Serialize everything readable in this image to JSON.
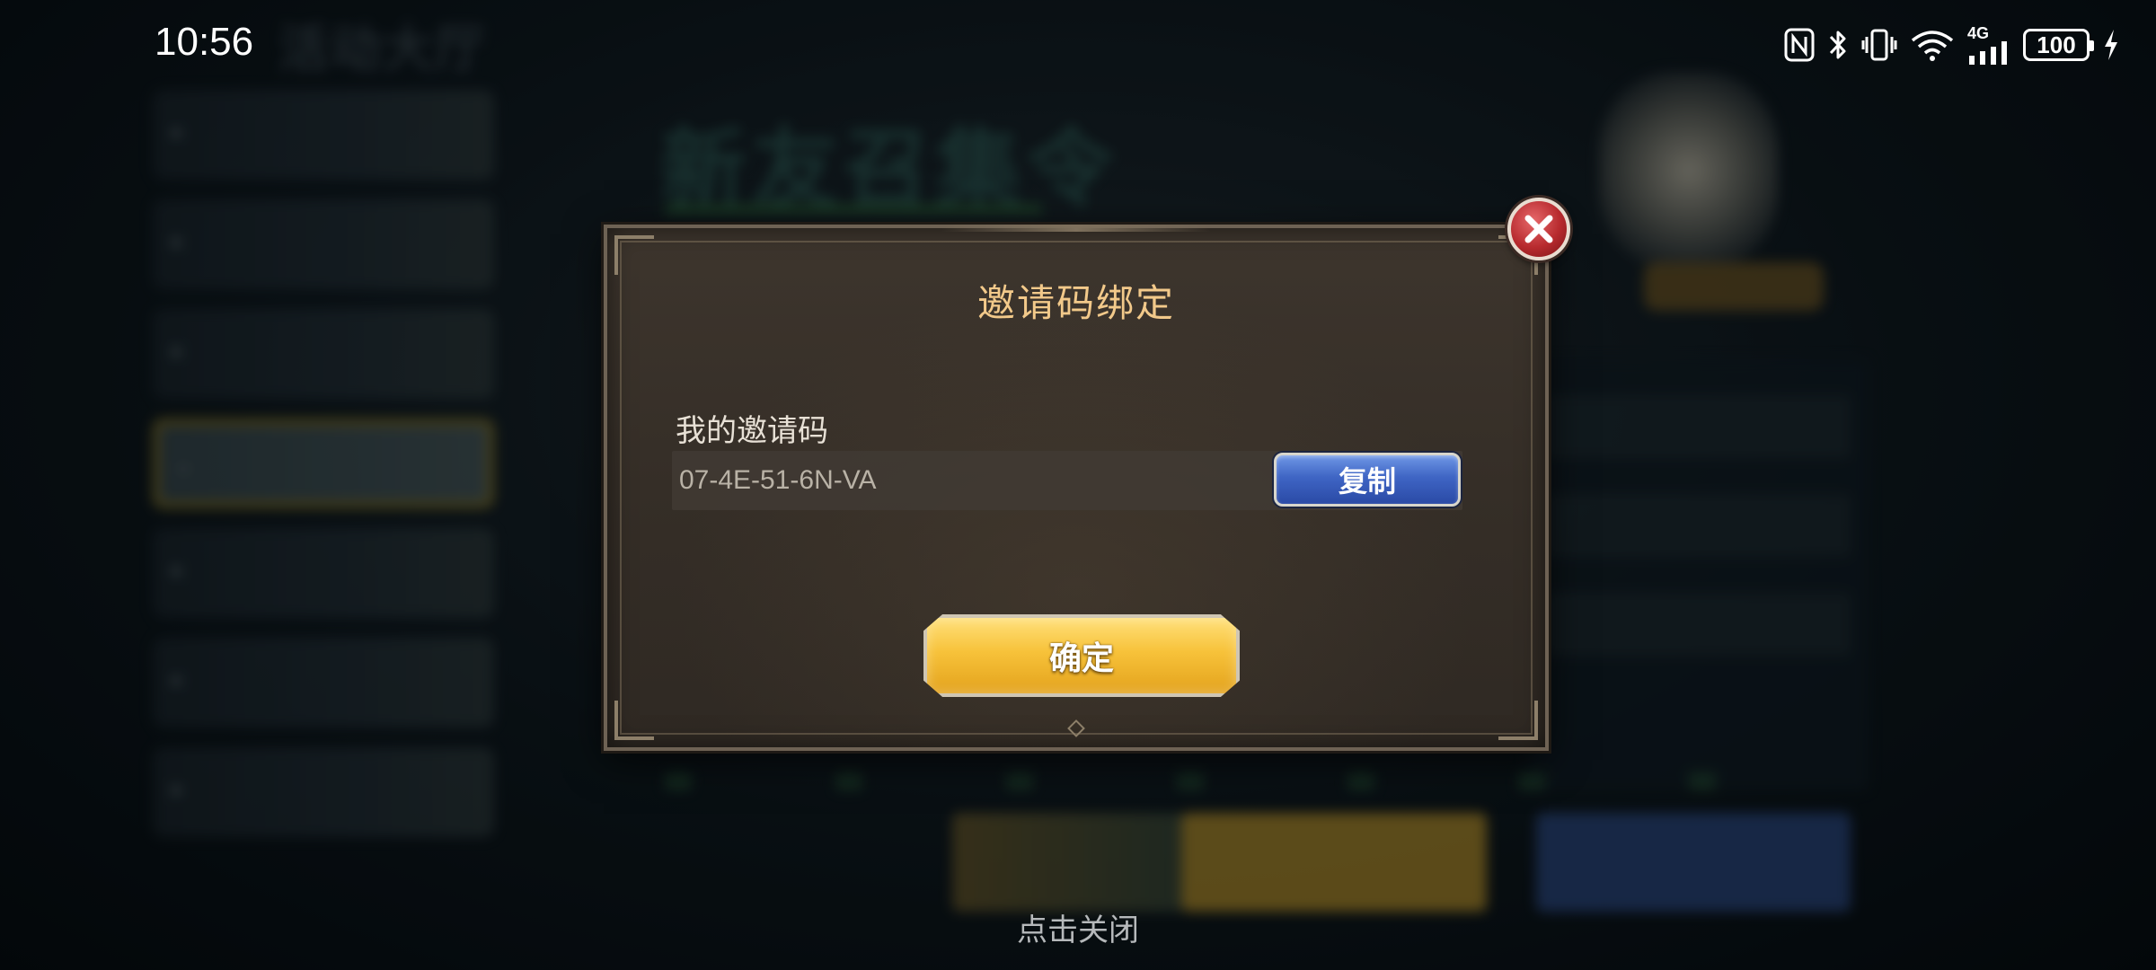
{
  "status_bar": {
    "time": "10:56",
    "icons": [
      "nfc-icon",
      "bluetooth-icon",
      "vibrate-icon",
      "wifi-icon",
      "signal-icon",
      "battery-icon",
      "charging-icon"
    ],
    "network_label": "4G",
    "battery_level": "100"
  },
  "background": {
    "hall_title": "活动大厅",
    "event_title": "新友召集令",
    "sidebar_items": [
      "",
      "",
      "",
      "",
      "",
      "",
      ""
    ],
    "sidebar_active_index": 3
  },
  "dialog": {
    "title": "邀请码绑定",
    "code_label": "我的邀请码",
    "code_value": "07-4E-51-6N-VA",
    "copy_label": "复制",
    "confirm_label": "确定",
    "close_icon": "close-icon"
  },
  "footer": {
    "tap_to_close": "点击关闭"
  },
  "colors": {
    "title_gold": "#f2c98a",
    "confirm_gold": "#f7c23a",
    "copy_blue": "#3f65c4",
    "close_red": "#b72a2e"
  }
}
